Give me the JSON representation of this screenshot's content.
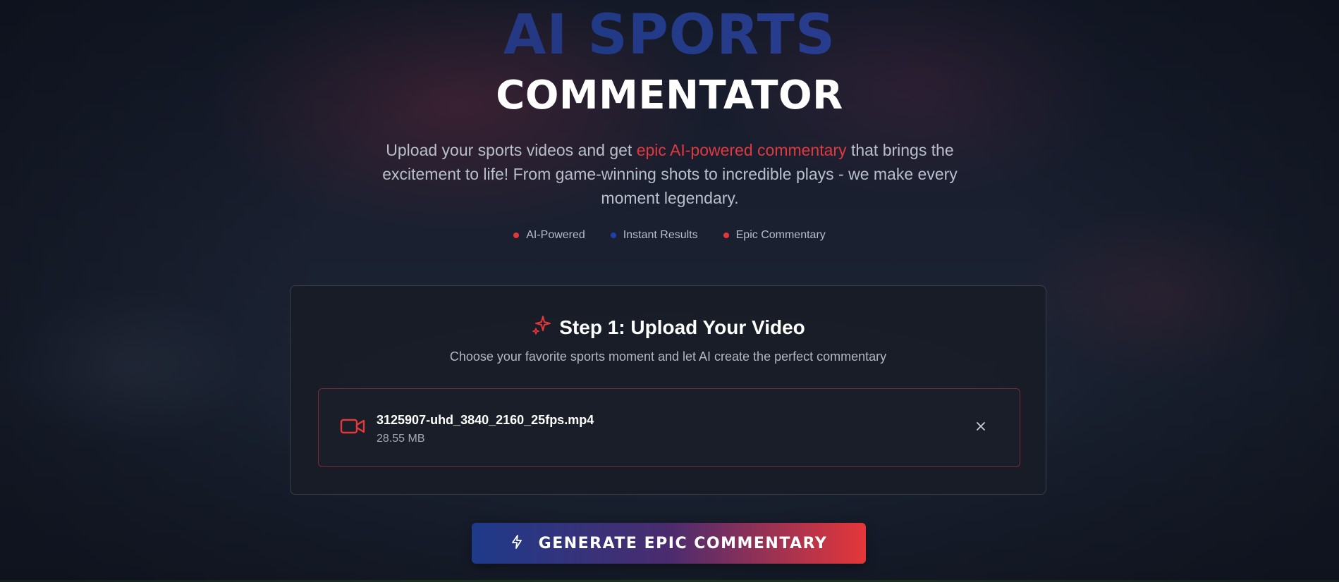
{
  "hero": {
    "title_line1": "AI SPORTS",
    "title_line2": "COMMENTATOR",
    "subtitle_before": "Upload your sports videos and get ",
    "subtitle_highlight": "epic AI-powered commentary",
    "subtitle_after": " that brings the excitement to life! From game-winning shots to incredible plays - we make every moment legendary.",
    "badges": [
      {
        "label": "AI-Powered",
        "color": "#e5373a"
      },
      {
        "label": "Instant Results",
        "color": "#1e40af"
      },
      {
        "label": "Epic Commentary",
        "color": "#e5373a"
      }
    ]
  },
  "upload_card": {
    "title": "Step 1: Upload Your Video",
    "subtitle": "Choose your favorite sports moment and let AI create the perfect commentary",
    "file": {
      "name": "3125907-uhd_3840_2160_25fps.mp4",
      "size": "28.55 MB",
      "icon": "video-camera-icon"
    },
    "remove_icon": "close-icon",
    "title_icon": "sparkles-icon"
  },
  "generate_button": {
    "label": "GENERATE EPIC COMMENTARY",
    "icon": "lightning-icon"
  },
  "colors": {
    "accent_red": "#e5373a",
    "accent_blue": "#1e3a8a",
    "card_border": "#3a4150",
    "file_border": "#7a2a34"
  }
}
